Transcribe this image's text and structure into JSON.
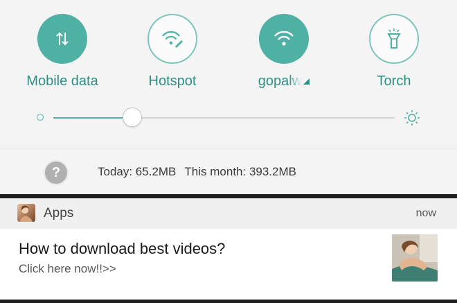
{
  "quick_settings": {
    "tiles": [
      {
        "label": "Mobile data",
        "state": "on",
        "icon": "mobile-data-icon"
      },
      {
        "label": "Hotspot",
        "state": "off",
        "icon": "hotspot-icon"
      },
      {
        "label": "gopalw",
        "state": "on",
        "icon": "wifi-icon"
      },
      {
        "label": "Torch",
        "state": "off",
        "icon": "torch-icon"
      }
    ],
    "brightness": {
      "level_percent": 25,
      "min_icon": "brightness-low-icon",
      "max_icon": "brightness-high-icon"
    }
  },
  "data_usage": {
    "help_symbol": "?",
    "today": "Today: 65.2MB",
    "month": "This month: 393.2MB"
  },
  "notification": {
    "app_name": "Apps",
    "time": "now",
    "title": "How to download best videos?",
    "text": "Click here now!!>>"
  },
  "colors": {
    "accent": "#4fb0a4",
    "label": "#2f8f82",
    "panel": "#f4f4f4",
    "background": "#1e1e1e"
  }
}
